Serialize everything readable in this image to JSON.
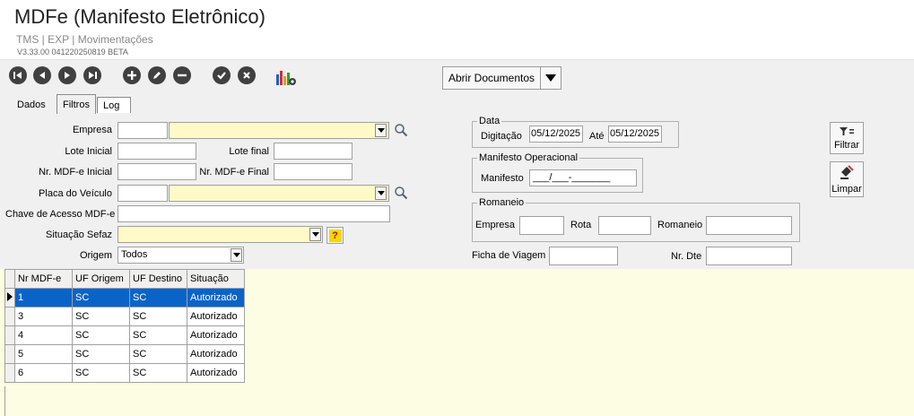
{
  "app": {
    "title": "MDFe (Manifesto Eletrônico)",
    "breadcrumb": "TMS | EXP | Movimentações",
    "version": "V3.33.00 041220250819 BETA"
  },
  "toolbar": {
    "abrir_documentos": "Abrir Documentos",
    "icons": [
      "first-icon",
      "prev-icon",
      "next-icon",
      "last-icon",
      "add-icon",
      "edit-icon",
      "remove-icon",
      "confirm-icon",
      "cancel-icon",
      "report-icon"
    ]
  },
  "tabs": [
    {
      "label": "Dados",
      "active": false
    },
    {
      "label": "Filtros",
      "active": true
    },
    {
      "label": "Log",
      "active": false
    }
  ],
  "filters": {
    "empresa_label": "Empresa",
    "lote_inicial_label": "Lote Inicial",
    "lote_final_label": "Lote final",
    "nr_mdfe_inicial_label": "Nr. MDF-e Inicial",
    "nr_mdfe_final_label": "Nr. MDF-e Final",
    "placa_label": "Placa do Veículo",
    "chave_label": "Chave de Acesso MDF-e",
    "situacao_label": "Situação Sefaz",
    "origem_label": "Origem",
    "origem_value": "Todos",
    "help_glyph": "?"
  },
  "data_group": {
    "legend": "Data",
    "digitacao_label": "Digitação",
    "digitacao_value": "05/12/2025",
    "ate_label": "Até",
    "ate_value": "05/12/2025"
  },
  "manifesto_group": {
    "legend": "Manifesto Operacional",
    "manifesto_label": "Manifesto",
    "manifesto_mask": "___/___-_______"
  },
  "romaneio_group": {
    "legend": "Romaneio",
    "empresa_label": "Empresa",
    "rota_label": "Rota",
    "romaneio_label": "Romaneio"
  },
  "ficha_label": "Ficha de Viagem",
  "nr_dte_label": "Nr. Dte",
  "buttons": {
    "filtrar": "Filtrar",
    "limpar": "Limpar"
  },
  "grid": {
    "columns": [
      "Nr MDF-e",
      "UF Origem",
      "UF Destino",
      "Situação"
    ],
    "rows": [
      [
        "1",
        "SC",
        "SC",
        "Autorizado"
      ],
      [
        "3",
        "SC",
        "SC",
        "Autorizado"
      ],
      [
        "4",
        "SC",
        "SC",
        "Autorizado"
      ],
      [
        "5",
        "SC",
        "SC",
        "Autorizado"
      ],
      [
        "6",
        "SC",
        "SC",
        "Autorizado"
      ]
    ],
    "selected_row": 0
  },
  "colors": {
    "selection": "#0a64c8",
    "required_field": "#fffac8",
    "grid_background": "#fdfde3",
    "toolbar_icon": "#404040"
  }
}
